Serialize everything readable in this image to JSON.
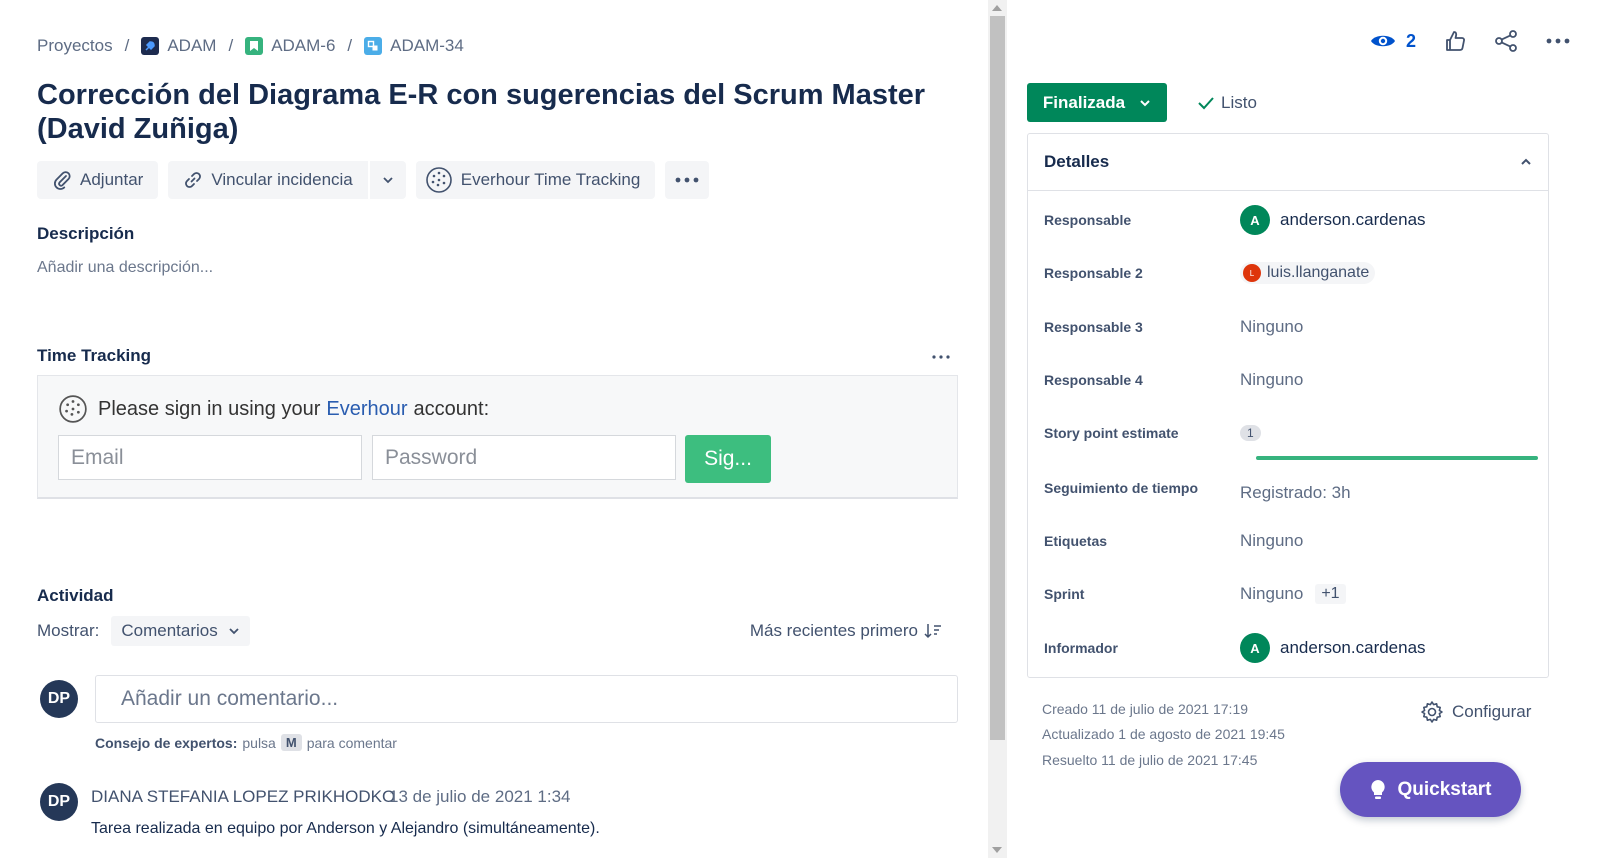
{
  "breadcrumb": {
    "root": "Proyectos",
    "project": "ADAM",
    "parent": "ADAM-6",
    "issue": "ADAM-34"
  },
  "issue": {
    "title": "Corrección del Diagrama E-R con sugerencias del Scrum Master (David Zuñiga)"
  },
  "actions": {
    "attach": "Adjuntar",
    "link": "Vincular incidencia",
    "everhour": "Everhour Time Tracking"
  },
  "description": {
    "label": "Descripción",
    "placeholder": "Añadir una descripción..."
  },
  "time_tracking": {
    "label": "Time Tracking",
    "sign_in_prefix": "Please sign in using your",
    "sign_in_link": "Everhour",
    "sign_in_suffix": "account:",
    "email_placeholder": "Email",
    "password_placeholder": "Password",
    "sign_in_button": "Sig..."
  },
  "activity": {
    "label": "Actividad",
    "show_label": "Mostrar:",
    "filter": "Comentarios",
    "sort": "Más recientes primero",
    "comment_placeholder": "Añadir un comentario...",
    "avatar_initials": "DP",
    "tip_bold": "Consejo de expertos:",
    "tip_text_1": "pulsa",
    "tip_key": "M",
    "tip_text_2": "para comentar",
    "comment": {
      "author": "DIANA STEFANIA LOPEZ PRIKHODKO",
      "date": "13 de julio de 2021 1:34",
      "text": "Tarea realizada en equipo por Anderson y Alejandro (simultáneamente)."
    }
  },
  "header": {
    "watchers": "2"
  },
  "status": {
    "label": "Finalizada",
    "resolution": "Listo"
  },
  "details": {
    "title": "Detalles",
    "fields": {
      "responsable": {
        "label": "Responsable",
        "value": "anderson.cardenas",
        "initial": "A"
      },
      "responsable2": {
        "label": "Responsable 2",
        "value": "luis.llanganate",
        "initial": "L"
      },
      "responsable3": {
        "label": "Responsable 3",
        "value": "Ninguno"
      },
      "responsable4": {
        "label": "Responsable 4",
        "value": "Ninguno"
      },
      "story_points": {
        "label": "Story point estimate",
        "value": "1"
      },
      "time_tracking": {
        "label": "Seguimiento de tiempo",
        "value": "Registrado: 3h",
        "progress": 1.0
      },
      "labels": {
        "label": "Etiquetas",
        "value": "Ninguno"
      },
      "sprint": {
        "label": "Sprint",
        "value": "Ninguno",
        "extra": "+1"
      },
      "reporter": {
        "label": "Informador",
        "value": "anderson.cardenas",
        "initial": "A"
      }
    }
  },
  "meta": {
    "created": "Creado 11 de julio de 2021 17:19",
    "updated": "Actualizado 1 de agosto de 2021 19:45",
    "resolved": "Resuelto 11 de julio de 2021 17:45",
    "configure": "Configurar"
  },
  "quickstart": "Quickstart",
  "colors": {
    "status_green": "#00875a",
    "everhour_green": "#3dbe7f",
    "link_blue": "#0052cc",
    "quickstart_purple": "#6554c0"
  }
}
